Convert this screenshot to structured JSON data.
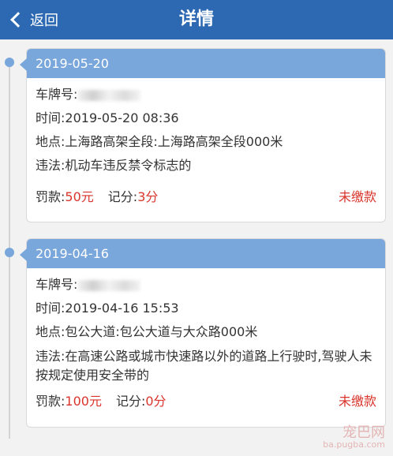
{
  "header": {
    "back_label": "返回",
    "title": "详情"
  },
  "records": [
    {
      "date": "2019-05-20",
      "plate_label": "车牌号:",
      "time_label": "时间:",
      "time_value": "2019-05-20 08:36",
      "place_label": "地点:",
      "place_value": "上海路高架全段:上海路高架全段000米",
      "violation_label": "违法:",
      "violation_value": "机动车违反禁令标志的",
      "fine_label": "罚款:",
      "fine_value": "50元",
      "points_label": "记分:",
      "points_value": "3分",
      "status": "未缴款"
    },
    {
      "date": "2019-04-16",
      "plate_label": "车牌号:",
      "time_label": "时间:",
      "time_value": "2019-04-16 15:53",
      "place_label": "地点:",
      "place_value": "包公大道:包公大道与大众路000米",
      "violation_label": "违法:",
      "violation_value": "在高速公路或城市快速路以外的道路上行驶时,驾驶人未按规定使用安全带的",
      "fine_label": "罚款:",
      "fine_value": "100元",
      "points_label": "记分:",
      "points_value": "0分",
      "status": "未缴款"
    }
  ],
  "watermark": {
    "text": "宠巴网",
    "url": "ba.pugba.com"
  },
  "colors": {
    "header": "#2d69b2",
    "card_header": "#7aa7db",
    "alert": "#d9342b"
  },
  "icons": {
    "back": "chevron-left-icon"
  }
}
